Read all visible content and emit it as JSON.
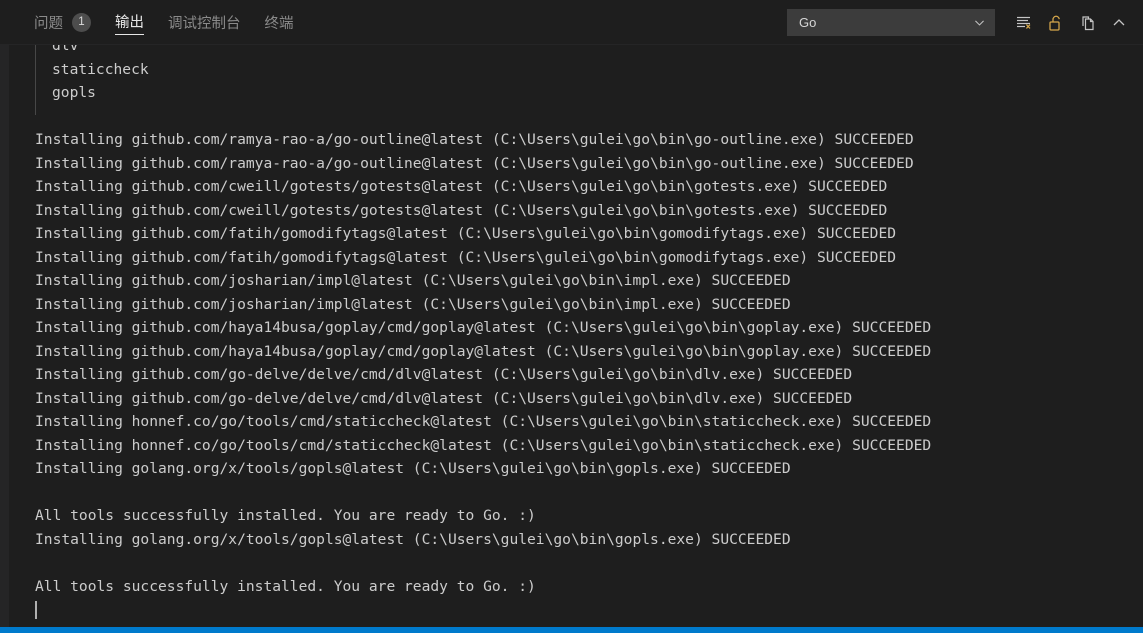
{
  "panel": {
    "tabs": [
      {
        "label": "问题",
        "badge": "1",
        "active": false,
        "name": "tab-problems"
      },
      {
        "label": "输出",
        "badge": "",
        "active": true,
        "name": "tab-output"
      },
      {
        "label": "调试控制台",
        "badge": "",
        "active": false,
        "name": "tab-debug-console"
      },
      {
        "label": "终端",
        "badge": "",
        "active": false,
        "name": "tab-terminal"
      }
    ],
    "channel_select": {
      "value": "Go",
      "icon": "chevron-down-icon"
    },
    "actions": [
      {
        "name": "clear-output-button",
        "icon": "clear-output-icon",
        "title": ""
      },
      {
        "name": "lock-scroll-button",
        "icon": "unlock-icon",
        "title": ""
      },
      {
        "name": "open-in-editor-button",
        "icon": "new-window-icon",
        "title": ""
      },
      {
        "name": "collapse-panel-button",
        "icon": "chevron-up-icon",
        "title": ""
      }
    ]
  },
  "colors": {
    "background": "#1e1e1e",
    "foreground": "#cccccc",
    "accent": "#007acc",
    "tab_active": "#e7e7e7",
    "tab_inactive": "#8a8a8a",
    "badge_bg": "#4d4d4d",
    "select_bg": "#3c3c3c",
    "unlock_icon": "#d7a84b",
    "indent_guide": "#474747"
  },
  "output": {
    "lines": [
      {
        "text": "dlv",
        "indent": true
      },
      {
        "text": "staticcheck",
        "indent": true
      },
      {
        "text": "gopls",
        "indent": true
      },
      {
        "text": "",
        "indent": false
      },
      {
        "text": "Installing github.com/ramya-rao-a/go-outline@latest (C:\\Users\\gulei\\go\\bin\\go-outline.exe) SUCCEEDED",
        "indent": false
      },
      {
        "text": "Installing github.com/ramya-rao-a/go-outline@latest (C:\\Users\\gulei\\go\\bin\\go-outline.exe) SUCCEEDED",
        "indent": false
      },
      {
        "text": "Installing github.com/cweill/gotests/gotests@latest (C:\\Users\\gulei\\go\\bin\\gotests.exe) SUCCEEDED",
        "indent": false
      },
      {
        "text": "Installing github.com/cweill/gotests/gotests@latest (C:\\Users\\gulei\\go\\bin\\gotests.exe) SUCCEEDED",
        "indent": false
      },
      {
        "text": "Installing github.com/fatih/gomodifytags@latest (C:\\Users\\gulei\\go\\bin\\gomodifytags.exe) SUCCEEDED",
        "indent": false
      },
      {
        "text": "Installing github.com/fatih/gomodifytags@latest (C:\\Users\\gulei\\go\\bin\\gomodifytags.exe) SUCCEEDED",
        "indent": false
      },
      {
        "text": "Installing github.com/josharian/impl@latest (C:\\Users\\gulei\\go\\bin\\impl.exe) SUCCEEDED",
        "indent": false
      },
      {
        "text": "Installing github.com/josharian/impl@latest (C:\\Users\\gulei\\go\\bin\\impl.exe) SUCCEEDED",
        "indent": false
      },
      {
        "text": "Installing github.com/haya14busa/goplay/cmd/goplay@latest (C:\\Users\\gulei\\go\\bin\\goplay.exe) SUCCEEDED",
        "indent": false
      },
      {
        "text": "Installing github.com/haya14busa/goplay/cmd/goplay@latest (C:\\Users\\gulei\\go\\bin\\goplay.exe) SUCCEEDED",
        "indent": false
      },
      {
        "text": "Installing github.com/go-delve/delve/cmd/dlv@latest (C:\\Users\\gulei\\go\\bin\\dlv.exe) SUCCEEDED",
        "indent": false
      },
      {
        "text": "Installing github.com/go-delve/delve/cmd/dlv@latest (C:\\Users\\gulei\\go\\bin\\dlv.exe) SUCCEEDED",
        "indent": false
      },
      {
        "text": "Installing honnef.co/go/tools/cmd/staticcheck@latest (C:\\Users\\gulei\\go\\bin\\staticcheck.exe) SUCCEEDED",
        "indent": false
      },
      {
        "text": "Installing honnef.co/go/tools/cmd/staticcheck@latest (C:\\Users\\gulei\\go\\bin\\staticcheck.exe) SUCCEEDED",
        "indent": false
      },
      {
        "text": "Installing golang.org/x/tools/gopls@latest (C:\\Users\\gulei\\go\\bin\\gopls.exe) SUCCEEDED",
        "indent": false
      },
      {
        "text": "",
        "indent": false
      },
      {
        "text": "All tools successfully installed. You are ready to Go. :)",
        "indent": false
      },
      {
        "text": "Installing golang.org/x/tools/gopls@latest (C:\\Users\\gulei\\go\\bin\\gopls.exe) SUCCEEDED",
        "indent": false
      },
      {
        "text": "",
        "indent": false
      },
      {
        "text": "All tools successfully installed. You are ready to Go. :)",
        "indent": false
      },
      {
        "text": "",
        "indent": false
      }
    ]
  }
}
